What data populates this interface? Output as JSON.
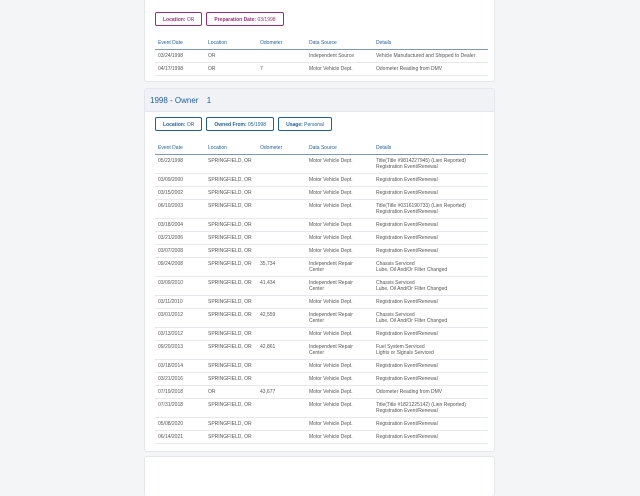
{
  "pre_owner": {
    "tags": [
      {
        "key": "Location:",
        "value": "OR"
      },
      {
        "key": "Preparation Date:",
        "value": "03/1998"
      }
    ],
    "columns": [
      "Event Date",
      "Location",
      "Odometer",
      "Data Source",
      "Details"
    ],
    "rows": [
      {
        "date": "03/24/1998",
        "location": "OR",
        "odometer": "",
        "source": "Independent Source",
        "details": "Vehicle Manufactured and Shipped to Dealer"
      },
      {
        "date": "04/17/1998",
        "location": "OR",
        "odometer": "7",
        "source": "Motor Vehicle Dept.",
        "details": "Odometer Reading from DMV"
      }
    ]
  },
  "owner": {
    "title_year": "1998 - Owner",
    "owner_number": "1",
    "tags": [
      {
        "key": "Location:",
        "value": "OR"
      },
      {
        "key": "Owned From:",
        "value": "05/1998"
      },
      {
        "key": "Usage:",
        "value": "Personal"
      }
    ],
    "columns": [
      "Event Date",
      "Location",
      "Odometer",
      "Data Source",
      "Details"
    ],
    "rows": [
      {
        "date": "05/22/1998",
        "location": "SPRINGFIELD, OR",
        "odometer": "",
        "source": "Motor Vehicle Dept.",
        "details": "Title(Title #9814227945) (Lien Reported)\nRegistration Event/Renewal"
      },
      {
        "date": "03/09/2000",
        "location": "SPRINGFIELD, OR",
        "odometer": "",
        "source": "Motor Vehicle Dept.",
        "details": "Registration Event/Renewal"
      },
      {
        "date": "03/15/2002",
        "location": "SPRINGFIELD, OR",
        "odometer": "",
        "source": "Motor Vehicle Dept.",
        "details": "Registration Event/Renewal"
      },
      {
        "date": "06/10/2003",
        "location": "SPRINGFIELD, OR",
        "odometer": "",
        "source": "Motor Vehicle Dept.",
        "details": "Title(Title #0316190733) (Lien Reported)\nRegistration Event/Renewal"
      },
      {
        "date": "03/18/2004",
        "location": "SPRINGFIELD, OR",
        "odometer": "",
        "source": "Motor Vehicle Dept.",
        "details": "Registration Event/Renewal"
      },
      {
        "date": "03/21/2006",
        "location": "SPRINGFIELD, OR",
        "odometer": "",
        "source": "Motor Vehicle Dept.",
        "details": "Registration Event/Renewal"
      },
      {
        "date": "03/07/2008",
        "location": "SPRINGFIELD, OR",
        "odometer": "",
        "source": "Motor Vehicle Dept.",
        "details": "Registration Event/Renewal"
      },
      {
        "date": "09/24/2008",
        "location": "SPRINGFIELD, OR",
        "odometer": "35,734",
        "source": "Independent Repair\nCenter",
        "details": "Chassis Serviced\nLube, Oil And/Or Filter Changed"
      },
      {
        "date": "03/09/2010",
        "location": "SPRINGFIELD, OR",
        "odometer": "41,434",
        "source": "Independent Repair\nCenter",
        "details": "Chassis Serviced\nLube, Oil And/Or Filter Changed"
      },
      {
        "date": "03/11/2010",
        "location": "SPRINGFIELD, OR",
        "odometer": "",
        "source": "Motor Vehicle Dept.",
        "details": "Registration Event/Renewal"
      },
      {
        "date": "03/01/2012",
        "location": "SPRINGFIELD, OR",
        "odometer": "42,559",
        "source": "Independent Repair\nCenter",
        "details": "Chassis Serviced\nLube, Oil And/Or Filter Changed"
      },
      {
        "date": "03/13/2012",
        "location": "SPRINGFIELD, OR",
        "odometer": "",
        "source": "Motor Vehicle Dept.",
        "details": "Registration Event/Renewal"
      },
      {
        "date": "09/20/2013",
        "location": "SPRINGFIELD, OR",
        "odometer": "42,861",
        "source": "Independent Repair\nCenter",
        "details": "Fuel System Serviced\nLights or Signals Serviced"
      },
      {
        "date": "03/18/2014",
        "location": "SPRINGFIELD, OR",
        "odometer": "",
        "source": "Motor Vehicle Dept.",
        "details": "Registration Event/Renewal"
      },
      {
        "date": "03/21/2016",
        "location": "SPRINGFIELD, OR",
        "odometer": "",
        "source": "Motor Vehicle Dept.",
        "details": "Registration Event/Renewal"
      },
      {
        "date": "07/19/2018",
        "location": "OR",
        "odometer": "43,677",
        "source": "Motor Vehicle Dept.",
        "details": "Odometer Reading from DMV"
      },
      {
        "date": "07/31/2018",
        "location": "SPRINGFIELD, OR",
        "odometer": "",
        "source": "Motor Vehicle Dept.",
        "details": "Title(Title #1821225142) (Lien Reported)\nRegistration Event/Renewal"
      },
      {
        "date": "05/08/2020",
        "location": "SPRINGFIELD, OR",
        "odometer": "",
        "source": "Motor Vehicle Dept.",
        "details": "Registration Event/Renewal"
      },
      {
        "date": "06/14/2021",
        "location": "SPRINGFIELD, OR",
        "odometer": "",
        "source": "Motor Vehicle Dept.",
        "details": "Registration Event/Renewal"
      }
    ]
  },
  "colors": {
    "accent_blue": "#1f5f9c",
    "accent_purple": "#9b2d7a"
  }
}
